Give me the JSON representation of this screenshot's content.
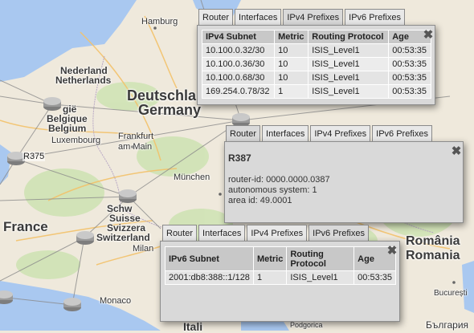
{
  "map": {
    "labels": {
      "hamburg": "Hamburg",
      "nederland": "Nederland",
      "netherlands": "Netherlands",
      "belgie": "gië",
      "belgique": "Belgique",
      "belgium": "Belgium",
      "luxembourg": "Luxembourg",
      "deutschland": "Deutschla",
      "germany": "Germany",
      "frankfurt": "Frankfurt",
      "am_main": "am Main",
      "munchen": "München",
      "france": "France",
      "schweiz": "Schw",
      "suisse": "Suisse",
      "svizzera": "Svizzera",
      "switzerland": "Switzerland",
      "milano": "Milan",
      "monaco": "Monaco",
      "romania1": "România",
      "romania2": "Romania",
      "bucuresti": "București",
      "podgorica": "Podgorica",
      "balgaria": "България",
      "italy_partial": "Itali"
    },
    "router_label": "R375"
  },
  "panel_ipv4": {
    "tabs": [
      "Router",
      "Interfaces",
      "IPv4 Prefixes",
      "IPv6 Prefixes"
    ],
    "active_tab": "IPv4 Prefixes",
    "columns": [
      "IPv4 Subnet",
      "Metric",
      "Routing Protocol",
      "Age"
    ],
    "rows": [
      [
        "10.100.0.32/30",
        "10",
        "ISIS_Level1",
        "00:53:35"
      ],
      [
        "10.100.0.36/30",
        "10",
        "ISIS_Level1",
        "00:53:35"
      ],
      [
        "10.100.0.68/30",
        "10",
        "ISIS_Level1",
        "00:53:35"
      ],
      [
        "169.254.0.78/32",
        "1",
        "ISIS_Level1",
        "00:53:35"
      ]
    ]
  },
  "panel_router": {
    "tabs": [
      "Router",
      "Interfaces",
      "IPv4 Prefixes",
      "IPv6 Prefixes"
    ],
    "active_tab": "Router",
    "name": "R387",
    "router_id": "router-id: 0000.0000.0387",
    "autonomous_system": "autonomous system: 1",
    "area_id": "area id: 49.0001"
  },
  "panel_ipv6": {
    "tabs": [
      "Router",
      "Interfaces",
      "IPv4 Prefixes",
      "IPv6 Prefixes"
    ],
    "active_tab": "IPv6 Prefixes",
    "columns": [
      "IPv6 Subnet",
      "Metric",
      "Routing Protocol",
      "Age"
    ],
    "rows": [
      [
        "2001:db8:388::1/128",
        "1",
        "ISIS_Level1",
        "00:53:35"
      ]
    ]
  },
  "colors": {
    "land": "#efe9dc",
    "sea": "#a9c8f0",
    "panel_bg": "#d9d9d9"
  }
}
